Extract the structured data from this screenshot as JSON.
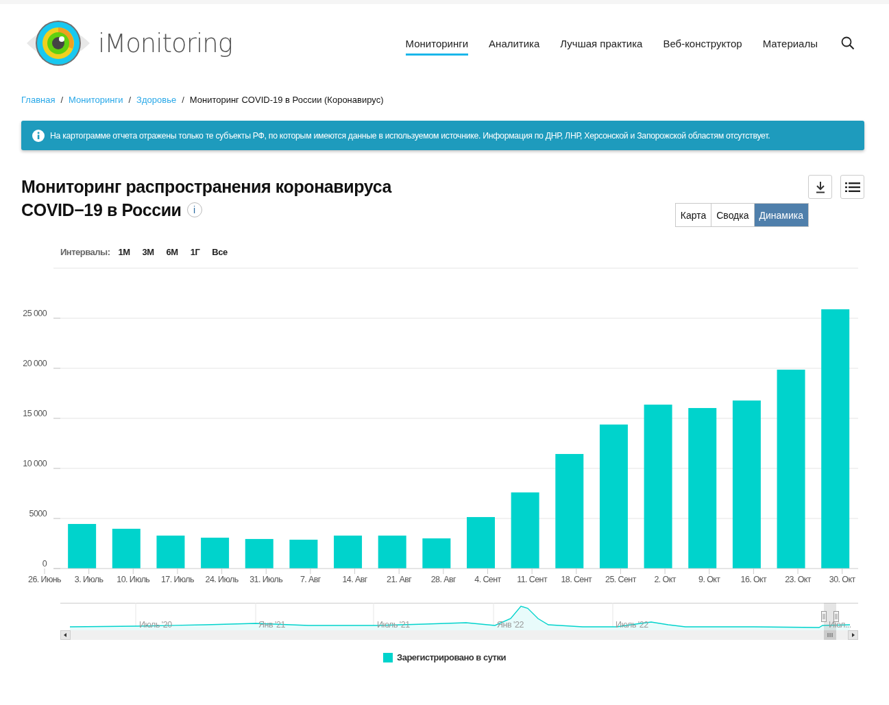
{
  "header": {
    "logo_text": "iMonitoring",
    "nav": [
      {
        "label": "Мониторинги",
        "selected": true
      },
      {
        "label": "Аналитика",
        "selected": false
      },
      {
        "label": "Лучшая практика",
        "selected": false
      },
      {
        "label": "Веб-конструктор",
        "selected": false
      },
      {
        "label": "Материалы",
        "selected": false
      }
    ]
  },
  "breadcrumbs": [
    {
      "label": "Главная",
      "kind": "link"
    },
    {
      "label": "Мониторинги",
      "kind": "link"
    },
    {
      "label": "Здоровье",
      "kind": "link"
    },
    {
      "label": "Мониторинг COVID-19 в России (Коронавирус)",
      "kind": "current"
    }
  ],
  "breadcrumb_separator": "/",
  "alert": {
    "text": "На картограмме отчета отражены только те субъекты РФ, по которым имеются данные в используемом источнике. Информация по ДНР,  ЛНР,  Херсонской и Запорожской областям отсутствует."
  },
  "report": {
    "title_lines": [
      "Мониторинг распространения коронавируса",
      "COVID−19 в России"
    ],
    "info_mark": "i",
    "views": [
      {
        "label": "Карта",
        "selected": false
      },
      {
        "label": "Сводка",
        "selected": false
      },
      {
        "label": "Динамика",
        "selected": true
      }
    ],
    "intervals_label": "Интервалы:",
    "intervals": [
      "1М",
      "3М",
      "6М",
      "1Г",
      "Все"
    ],
    "chart_data": {
      "type": "bar",
      "categories": [
        "26. Июнь",
        "3. Июль",
        "10. Июль",
        "17. Июль",
        "24. Июль",
        "31. Июль",
        "7. Авг",
        "14. Авг",
        "21. Авг",
        "28. Авг",
        "4. Сент",
        "11. Сент",
        "18. Сент",
        "25. Сент",
        "2. Окт",
        "9. Окт",
        "16. Окт",
        "23. Окт",
        "30. Окт"
      ],
      "series": [
        {
          "name": "Зарегистрировано в сутки",
          "color": "#00d3cc",
          "values": [
            null,
            4450,
            3970,
            3290,
            3080,
            2950,
            2880,
            3290,
            3290,
            3010,
            5140,
            7600,
            11440,
            14380,
            16370,
            16030,
            16780,
            19860,
            25890
          ]
        }
      ],
      "ylim": [
        0,
        30000
      ],
      "grid": true,
      "yticks": [
        {
          "value": 0,
          "label": "0"
        },
        {
          "value": 5000,
          "label": "5000"
        },
        {
          "value": 10000,
          "label": "10 000"
        },
        {
          "value": 15000,
          "label": "15 000"
        },
        {
          "value": 20000,
          "label": "20 000"
        },
        {
          "value": 25000,
          "label": "25 000"
        }
      ]
    },
    "navigator_labels": [
      "Июль '20",
      "Янв '21",
      "Июль '21",
      "Янв '22",
      "Июль '22",
      "Июл..."
    ]
  }
}
